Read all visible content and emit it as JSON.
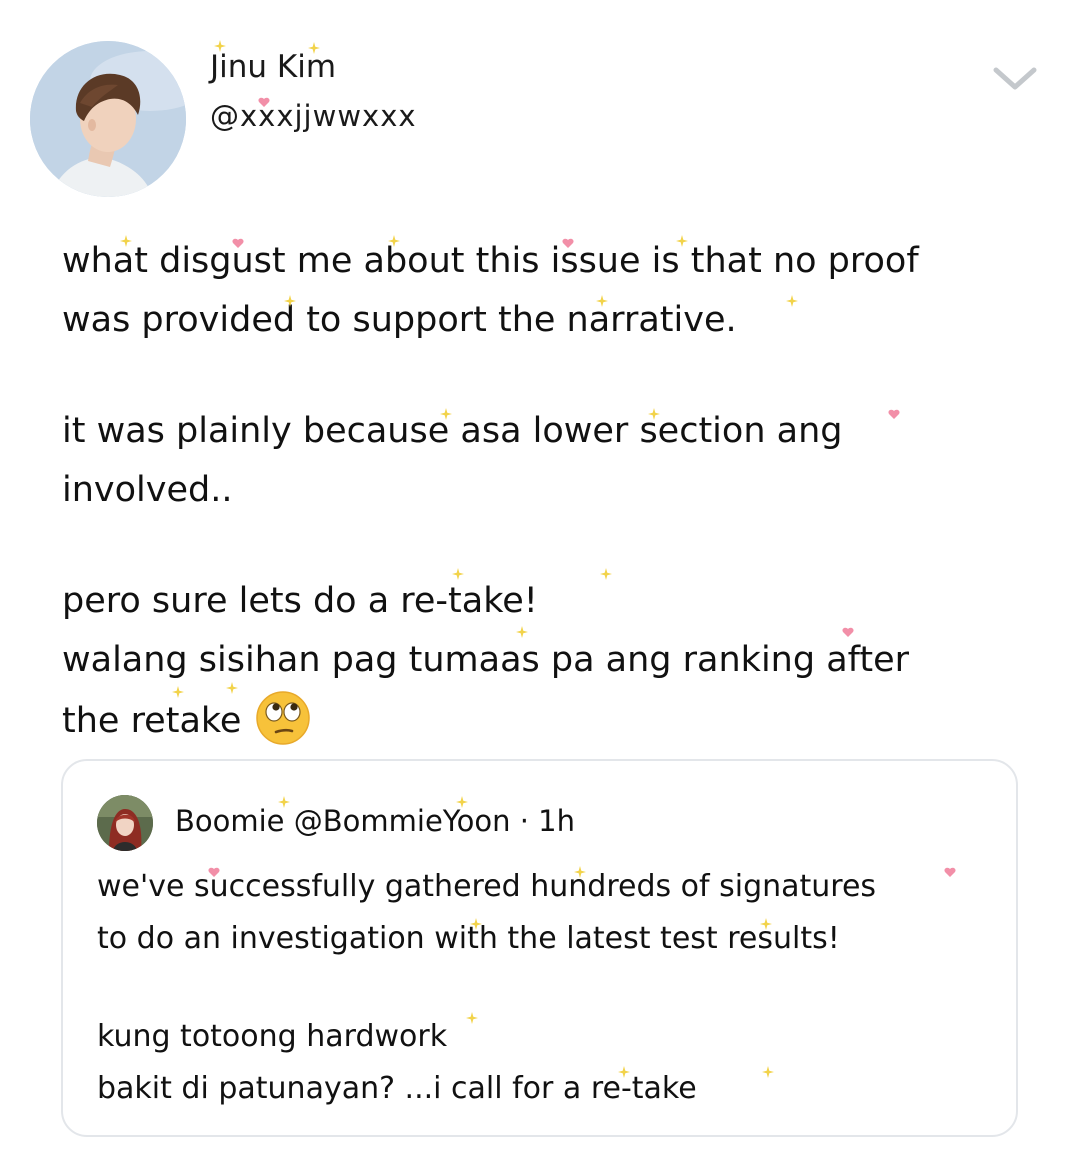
{
  "tweet": {
    "author": {
      "display_name": "Jinu Kim",
      "handle": "@xxxjjwwxxx"
    },
    "menu_icon": "chevron-down-icon",
    "text_lines": [
      "what disgust me about this issue is that no proof",
      "was provided to support the narrative.",
      "it was plainly because asa lower section ang",
      "involved..",
      "pero sure lets do a re-take!",
      "walang sisihan pag tumaas pa ang ranking after",
      "the retake"
    ],
    "trailing_emoji": "face-with-rolling-eyes"
  },
  "quoted_tweet": {
    "display_name": "Boomie",
    "handle": "@BommieYoon",
    "separator": "·",
    "time": "1h",
    "text_lines": [
      "we've successfully gathered hundreds of signatures",
      "to do an investigation with the latest test results!",
      "kung totoong hardwork",
      "bakit di patunayan? ...i call for a re-take"
    ]
  },
  "colors": {
    "text": "#111111",
    "card_border": "#e3e6ea",
    "chevron": "#c4c8cc",
    "sparkle_yellow": "#f2d34a",
    "heart_pink": "#f28fa8"
  }
}
